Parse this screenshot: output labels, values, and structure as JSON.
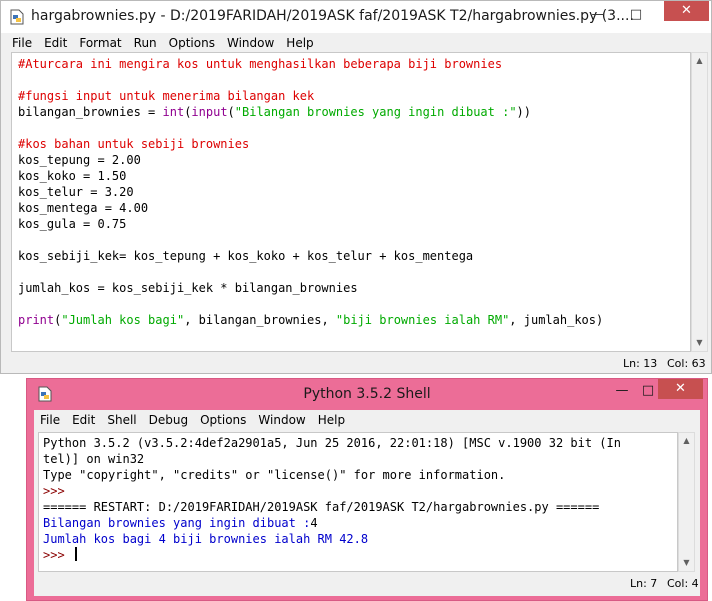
{
  "editor": {
    "title": "hargabrownies.py - D:/2019FARIDAH/2019ASK faf/2019ASK T2/hargabrownies.py (3....",
    "controls": {
      "minimize": "—",
      "maximize": "□",
      "close": "✕"
    },
    "menu": [
      "File",
      "Edit",
      "Format",
      "Run",
      "Options",
      "Window",
      "Help"
    ],
    "code": {
      "l1": "#Aturcara ini mengira kos untuk menghasilkan beberapa biji brownies",
      "l3": "#fungsi input untuk menerima bilangan kek",
      "l4a": "bilangan_brownies = ",
      "l4b": "int",
      "l4c": "(",
      "l4d": "input",
      "l4e": "(",
      "l4f": "\"Bilangan brownies yang ingin dibuat :\"",
      "l4g": "))",
      "l6": "#kos bahan untuk sebiji brownies",
      "l7": "kos_tepung = 2.00",
      "l8": "kos_koko = 1.50",
      "l9": "kos_telur = 3.20",
      "l10": "kos_mentega = 4.00",
      "l11": "kos_gula = 0.75",
      "l13": "kos_sebiji_kek= kos_tepung + kos_koko + kos_telur + kos_mentega",
      "l15": "jumlah_kos = kos_sebiji_kek * bilangan_brownies",
      "l17a": "print",
      "l17b": "(",
      "l17c": "\"Jumlah kos bagi\"",
      "l17d": ", bilangan_brownies, ",
      "l17e": "\"biji brownies ialah RM\"",
      "l17f": ", jumlah_kos)"
    },
    "status": {
      "ln": "Ln: 13",
      "col": "Col: 63"
    }
  },
  "shell": {
    "title": "Python 3.5.2 Shell",
    "controls": {
      "minimize": "—",
      "maximize": "□",
      "close": "✕"
    },
    "menu": [
      "File",
      "Edit",
      "Shell",
      "Debug",
      "Options",
      "Window",
      "Help"
    ],
    "lines": {
      "s1": "Python 3.5.2 (v3.5.2:4def2a2901a5, Jun 25 2016, 22:01:18) [MSC v.1900 32 bit (In",
      "s2": "tel)] on win32",
      "s3": "Type \"copyright\", \"credits\" or \"license()\" for more information.",
      "s4": ">>> ",
      "s5": "====== RESTART: D:/2019FARIDAH/2019ASK faf/2019ASK T2/hargabrownies.py ======",
      "s6a": "Bilangan brownies yang ingin dibuat :",
      "s6b": "4",
      "s7": "Jumlah kos bagi 4 biji brownies ialah RM 42.8",
      "s8": ">>> "
    },
    "status": {
      "ln": "Ln: 7",
      "col": "Col: 4"
    }
  },
  "colors": {
    "comment": "#dd0000",
    "keyword": "#900090",
    "string": "#00aa00",
    "output": "#0000cc",
    "shell_frame": "#ec6d97",
    "close_button": "#c75050"
  }
}
